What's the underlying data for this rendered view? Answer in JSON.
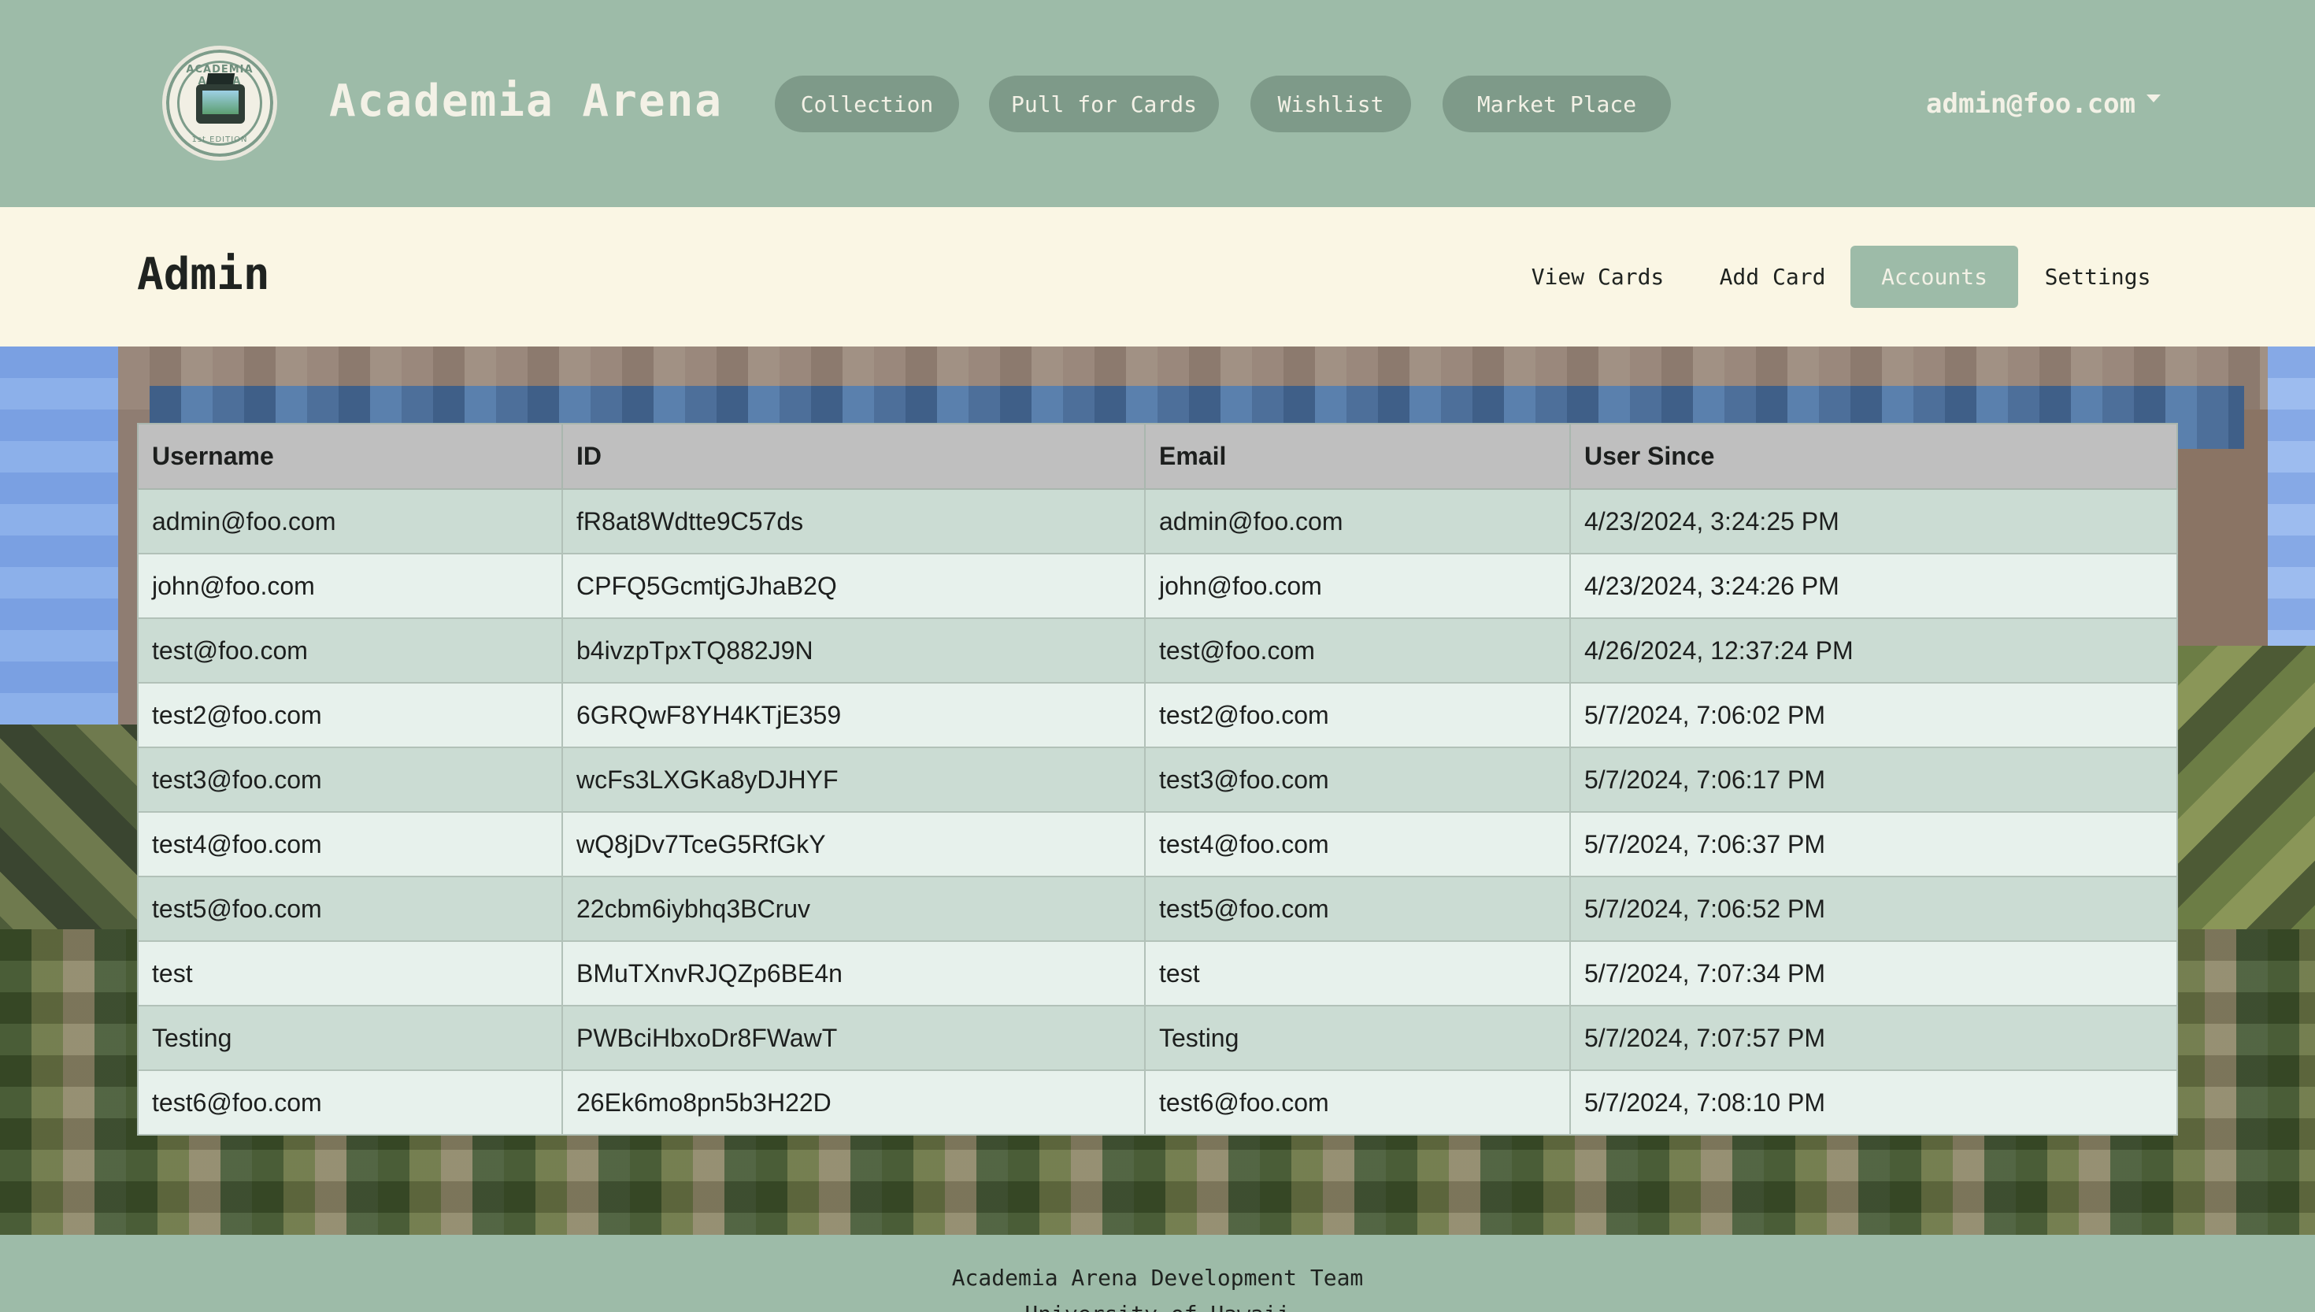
{
  "app": {
    "brand": "Academia Arena",
    "logo_text": "ACADEMIA ARENA",
    "logo_sub": "1st EDITION"
  },
  "nav": {
    "items": [
      {
        "label": "Collection"
      },
      {
        "label": "Pull for Cards"
      },
      {
        "label": "Wishlist"
      },
      {
        "label": "Market Place"
      }
    ],
    "user": "admin@foo.com"
  },
  "admin": {
    "title": "Admin",
    "tabs": [
      {
        "label": "View Cards",
        "active": false
      },
      {
        "label": "Add Card",
        "active": false
      },
      {
        "label": "Accounts",
        "active": true
      },
      {
        "label": "Settings",
        "active": false
      }
    ]
  },
  "table": {
    "columns": [
      "Username",
      "ID",
      "Email",
      "User Since"
    ],
    "rows": [
      [
        "admin@foo.com",
        "fR8at8Wdtte9C57ds",
        "admin@foo.com",
        "4/23/2024, 3:24:25 PM"
      ],
      [
        "john@foo.com",
        "CPFQ5GcmtjGJhaB2Q",
        "john@foo.com",
        "4/23/2024, 3:24:26 PM"
      ],
      [
        "test@foo.com",
        "b4ivzpTpxTQ882J9N",
        "test@foo.com",
        "4/26/2024, 12:37:24 PM"
      ],
      [
        "test2@foo.com",
        "6GRQwF8YH4KTjE359",
        "test2@foo.com",
        "5/7/2024, 7:06:02 PM"
      ],
      [
        "test3@foo.com",
        "wcFs3LXGKa8yDJHYF",
        "test3@foo.com",
        "5/7/2024, 7:06:17 PM"
      ],
      [
        "test4@foo.com",
        "wQ8jDv7TceG5RfGkY",
        "test4@foo.com",
        "5/7/2024, 7:06:37 PM"
      ],
      [
        "test5@foo.com",
        "22cbm6iybhq3BCruv",
        "test5@foo.com",
        "5/7/2024, 7:06:52 PM"
      ],
      [
        "test",
        "BMuTXnvRJQZp6BE4n",
        "test",
        "5/7/2024, 7:07:34 PM"
      ],
      [
        "Testing",
        "PWBciHbxoDr8FWawT",
        "Testing",
        "5/7/2024, 7:07:57 PM"
      ],
      [
        "test6@foo.com",
        "26Ek6mo8pn5b3H22D",
        "test6@foo.com",
        "5/7/2024, 7:08:10 PM"
      ]
    ]
  },
  "footer": {
    "line1": "Academia Arena Development Team",
    "line2": "University of Hawaii"
  },
  "colors": {
    "header_bg": "#9dbba8",
    "subheader_bg": "#faf6e4",
    "nav_button": "#7e9a89",
    "active_tab": "#9dbba8",
    "row_odd": "#cbdcd3",
    "row_even": "#e7f1ec",
    "table_header": "#bfbfbf"
  },
  "icons": {
    "logo": "academia-arena-logo",
    "user_caret": "chevron-down-icon"
  }
}
